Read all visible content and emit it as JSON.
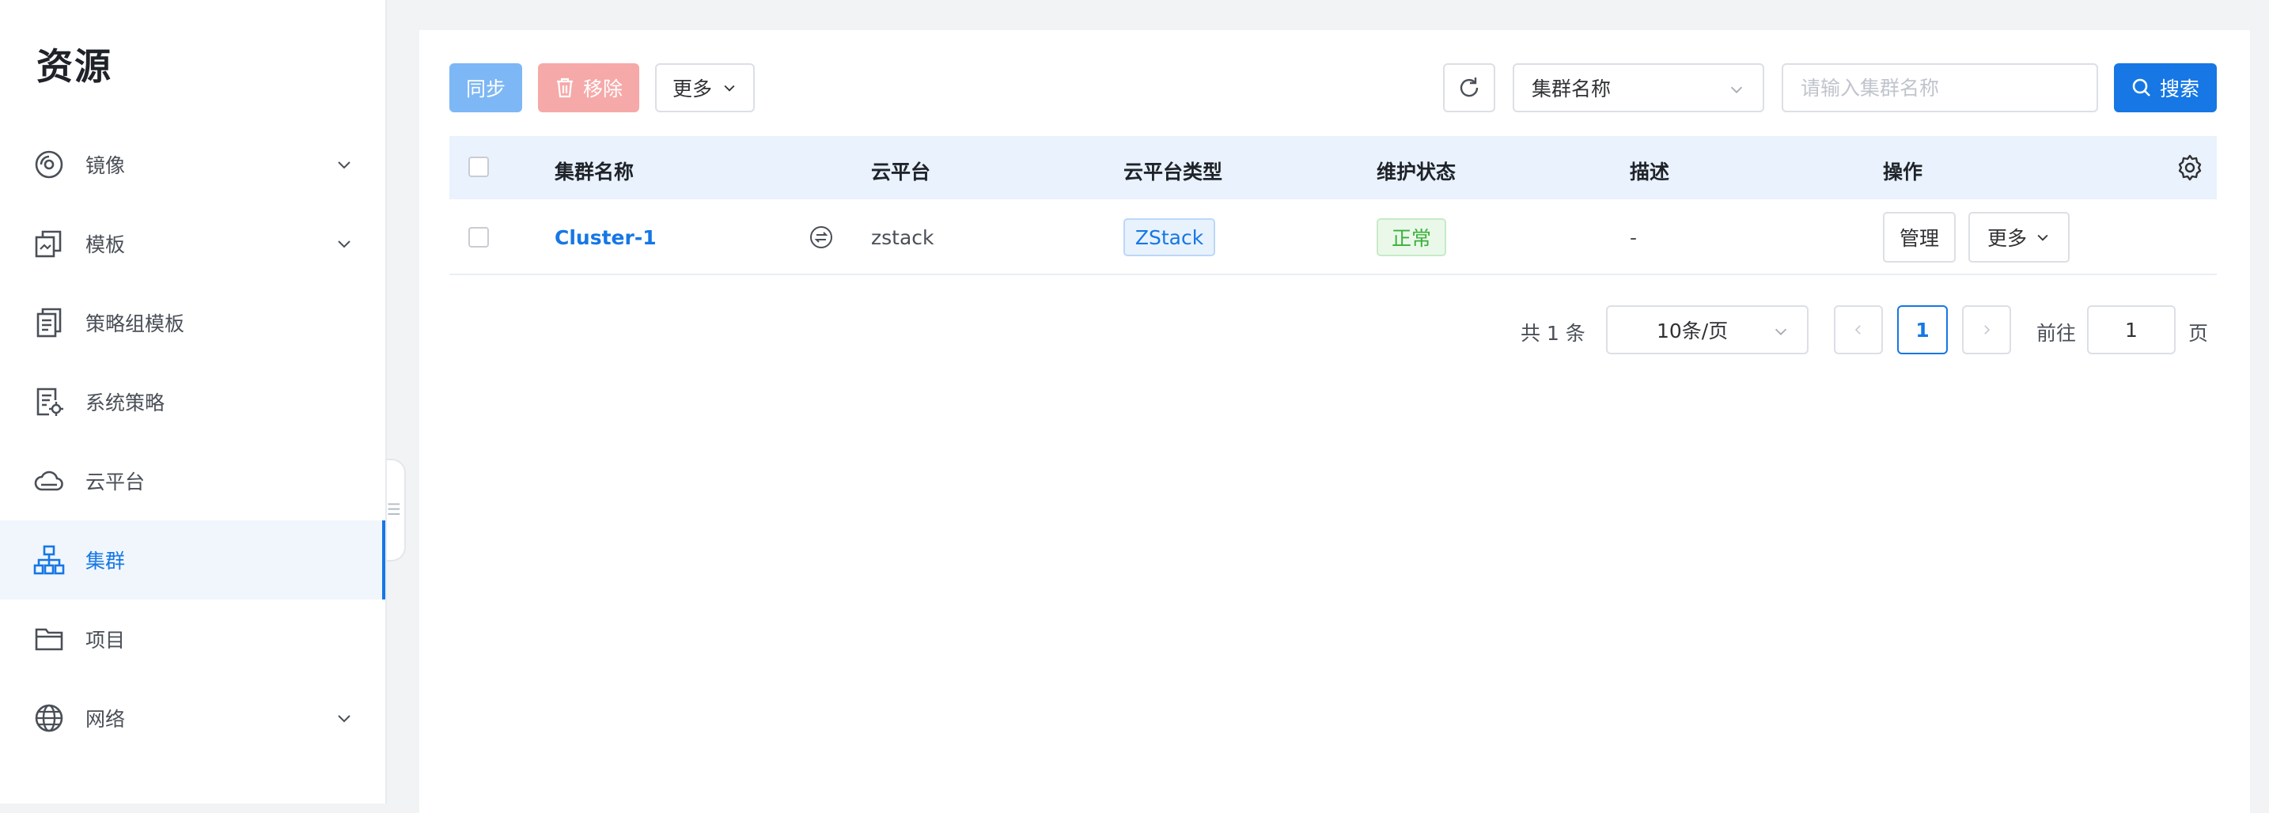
{
  "sidebar": {
    "title": "资源",
    "items": [
      {
        "label": "镜像",
        "icon": "disc-icon",
        "has_chevron": true
      },
      {
        "label": "模板",
        "icon": "template-icon",
        "has_chevron": true
      },
      {
        "label": "策略组模板",
        "icon": "document-list-icon",
        "has_chevron": false
      },
      {
        "label": "系统策略",
        "icon": "document-gear-icon",
        "has_chevron": false
      },
      {
        "label": "云平台",
        "icon": "cloud-icon",
        "has_chevron": false
      },
      {
        "label": "集群",
        "icon": "cluster-icon",
        "has_chevron": false,
        "active": true
      },
      {
        "label": "项目",
        "icon": "folder-icon",
        "has_chevron": false
      },
      {
        "label": "网络",
        "icon": "globe-icon",
        "has_chevron": true
      }
    ]
  },
  "toolbar": {
    "sync_label": "同步",
    "remove_label": "移除",
    "more_label": "更多",
    "search_field_select": "集群名称",
    "search_placeholder": "请输入集群名称",
    "search_label": "搜索"
  },
  "table": {
    "columns": [
      "集群名称",
      "云平台",
      "云平台类型",
      "维护状态",
      "描述",
      "操作"
    ],
    "rows": [
      {
        "name": "Cluster-1",
        "platform": "zstack",
        "platform_type": "ZStack",
        "status": "正常",
        "description": "-",
        "action_manage": "管理",
        "action_more": "更多"
      }
    ]
  },
  "pagination": {
    "total_text": "共 1 条",
    "page_size": "10条/页",
    "current_page": "1",
    "goto_label": "前往",
    "goto_value": "1",
    "page_suffix": "页"
  },
  "colors": {
    "accent": "#1677e5",
    "sync_button": "#7db7f5",
    "remove_button": "#f6a9a9",
    "status_ok": "#3ab13a"
  }
}
